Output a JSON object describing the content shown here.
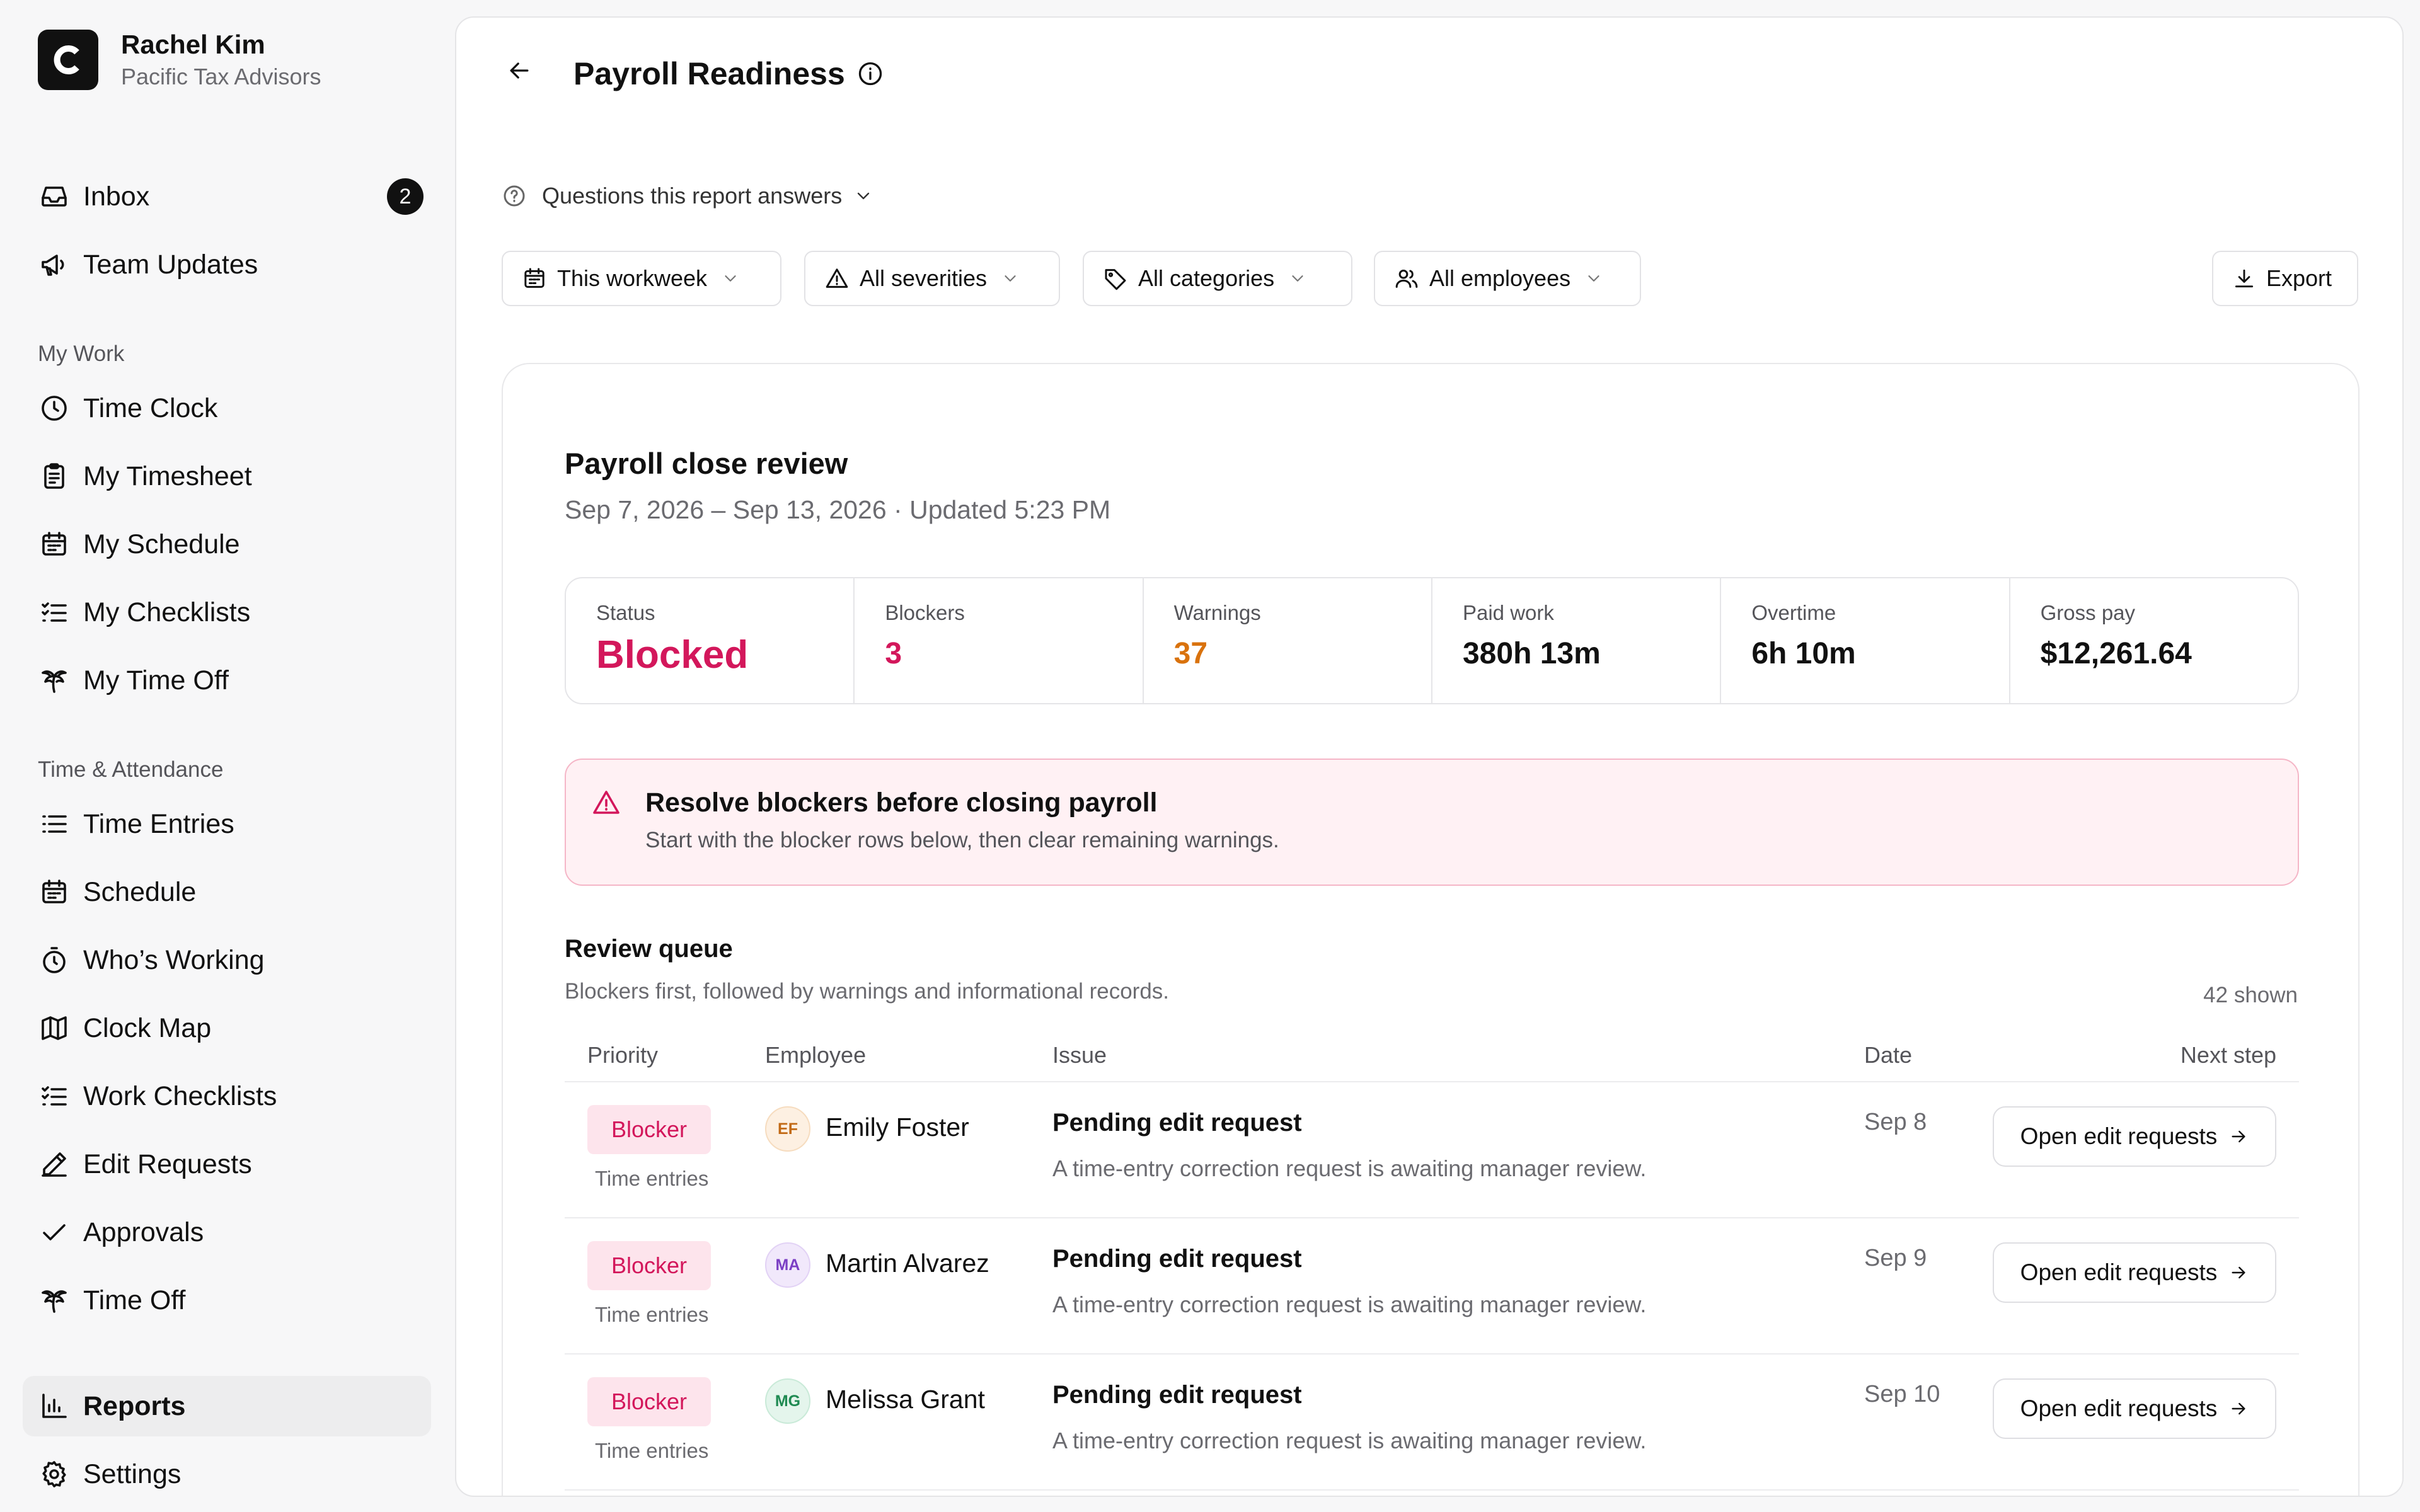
{
  "user": {
    "name": "Rachel Kim",
    "org": "Pacific Tax Advisors",
    "logo_letter": "C"
  },
  "nav_top": [
    {
      "label": "Inbox",
      "icon": "inbox-icon",
      "badge": "2"
    },
    {
      "label": "Team Updates",
      "icon": "megaphone-icon"
    }
  ],
  "sections": {
    "my_work": "My Work",
    "time_attendance": "Time & Attendance"
  },
  "nav_my_work": [
    {
      "label": "Time Clock",
      "icon": "clock-icon"
    },
    {
      "label": "My Timesheet",
      "icon": "clipboard-icon"
    },
    {
      "label": "My Schedule",
      "icon": "calendar-icon"
    },
    {
      "label": "My Checklists",
      "icon": "checklist-icon"
    },
    {
      "label": "My Time Off",
      "icon": "palm-tree-icon"
    }
  ],
  "nav_ta": [
    {
      "label": "Time Entries",
      "icon": "list-icon"
    },
    {
      "label": "Schedule",
      "icon": "calendar-icon"
    },
    {
      "label": "Who’s Working",
      "icon": "stopwatch-icon"
    },
    {
      "label": "Clock Map",
      "icon": "map-icon"
    },
    {
      "label": "Work Checklists",
      "icon": "checklist-icon"
    },
    {
      "label": "Edit Requests",
      "icon": "pencil-icon"
    },
    {
      "label": "Approvals",
      "icon": "check-icon"
    },
    {
      "label": "Time Off",
      "icon": "palm-tree-icon"
    }
  ],
  "nav_bottom": [
    {
      "label": "Reports",
      "icon": "bar-chart-icon",
      "active": true
    },
    {
      "label": "Settings",
      "icon": "gear-icon"
    }
  ],
  "page": {
    "title": "Payroll Readiness",
    "questions": "Questions this report answers"
  },
  "filters": {
    "workweek": "This workweek",
    "severities": "All severities",
    "categories": "All categories",
    "employees": "All employees",
    "export": "Export"
  },
  "review": {
    "title": "Payroll close review",
    "subtitle": "Sep 7, 2026 – Sep 13, 2026 · Updated 5:23 PM",
    "stats": [
      {
        "label": "Status",
        "value": "Blocked"
      },
      {
        "label": "Blockers",
        "value": "3"
      },
      {
        "label": "Warnings",
        "value": "37"
      },
      {
        "label": "Paid work",
        "value": "380h 13m"
      },
      {
        "label": "Overtime",
        "value": "6h 10m"
      },
      {
        "label": "Gross pay",
        "value": "$12,261.64"
      }
    ],
    "alert": {
      "title": "Resolve blockers before closing payroll",
      "subtitle": "Start with the blocker rows below, then clear remaining warnings."
    }
  },
  "queue": {
    "title": "Review queue",
    "subtitle": "Blockers first, followed by warnings and informational records.",
    "count": "42 shown",
    "columns": [
      "Priority",
      "Employee",
      "Issue",
      "Date",
      "Next step"
    ],
    "rows": [
      {
        "priority": "Blocker",
        "category": "Time entries",
        "initials": "EF",
        "avatar_bg": "#fdf0e2",
        "avatar_fg": "#c26a16",
        "employee": "Emily Foster",
        "issue": "Pending edit request",
        "desc": "A time-entry correction request is awaiting manager review.",
        "date": "Sep 8",
        "action": "Open edit requests"
      },
      {
        "priority": "Blocker",
        "category": "Time entries",
        "initials": "MA",
        "avatar_bg": "#f1e8fb",
        "avatar_fg": "#7b3fc4",
        "employee": "Martin Alvarez",
        "issue": "Pending edit request",
        "desc": "A time-entry correction request is awaiting manager review.",
        "date": "Sep 9",
        "action": "Open edit requests"
      },
      {
        "priority": "Blocker",
        "category": "Time entries",
        "initials": "MG",
        "avatar_bg": "#e4f5ec",
        "avatar_fg": "#1f8a52",
        "employee": "Melissa Grant",
        "issue": "Pending edit request",
        "desc": "A time-entry correction request is awaiting manager review.",
        "date": "Sep 10",
        "action": "Open edit requests"
      }
    ]
  }
}
